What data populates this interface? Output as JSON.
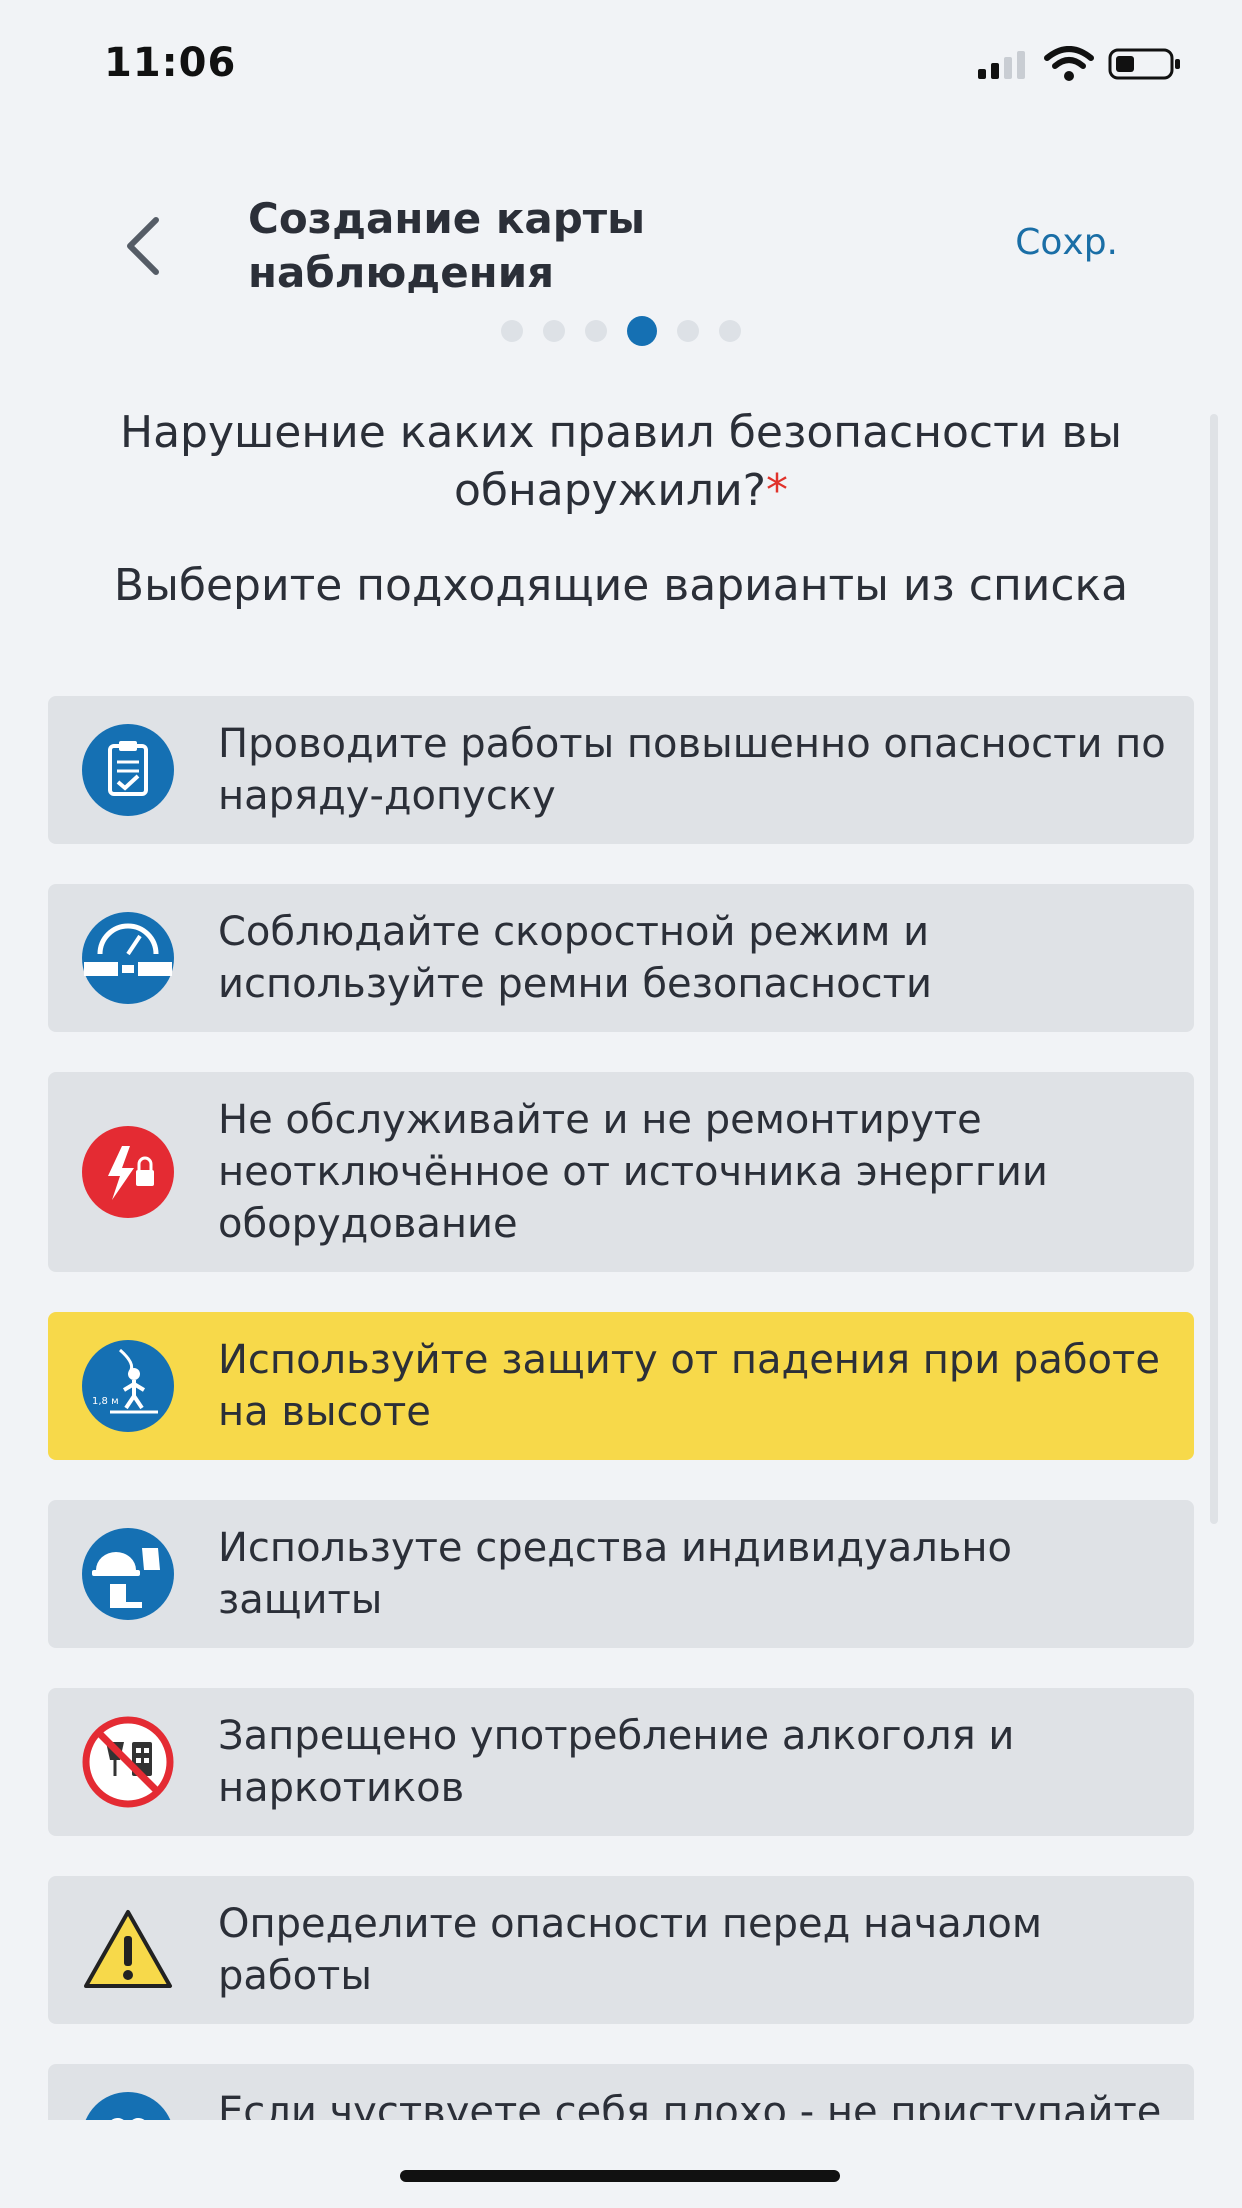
{
  "status_bar": {
    "time": "11:06"
  },
  "header": {
    "title": "Создание карты наблюдения",
    "save_label": "Сохр."
  },
  "pager": {
    "total": 6,
    "active_index": 3
  },
  "question": {
    "text": "Нарушение каких правил безопасности вы обнаружили?",
    "required_mark": "*",
    "hint": "Выберите подходящие варианты из списка"
  },
  "options": [
    {
      "label": "Проводите работы повышенно опасности по наряду-допуску",
      "icon": "permit-clipboard-icon",
      "selected": false
    },
    {
      "label": "Соблюдайте скоростной режим и используйте ремни безопасности",
      "icon": "seatbelt-speed-icon",
      "selected": false
    },
    {
      "label": "Не обслуживайте и не ремонтируте неотключённое от источника энерггии оборудование",
      "icon": "energy-lockout-icon",
      "selected": false
    },
    {
      "label": "Используйте защиту от падения при работе на высоте",
      "icon": "fall-protection-icon",
      "selected": true
    },
    {
      "label": "Используте средства индивидуально защиты",
      "icon": "ppe-icon",
      "selected": false
    },
    {
      "label": "Запрещено употребление алкоголя и наркотиков",
      "icon": "no-alcohol-drugs-icon",
      "selected": false
    },
    {
      "label": "Определите опасности перед началом работы",
      "icon": "warning-triangle-icon",
      "selected": false
    },
    {
      "label": "Если чуствуете себя плохо - не приступайте к работе и",
      "icon": "health-icon",
      "selected": false
    }
  ],
  "colors": {
    "accent": "#1570b3",
    "selected": "#f7d94a",
    "required": "#e0322b",
    "danger_icon": "#e42b33"
  }
}
